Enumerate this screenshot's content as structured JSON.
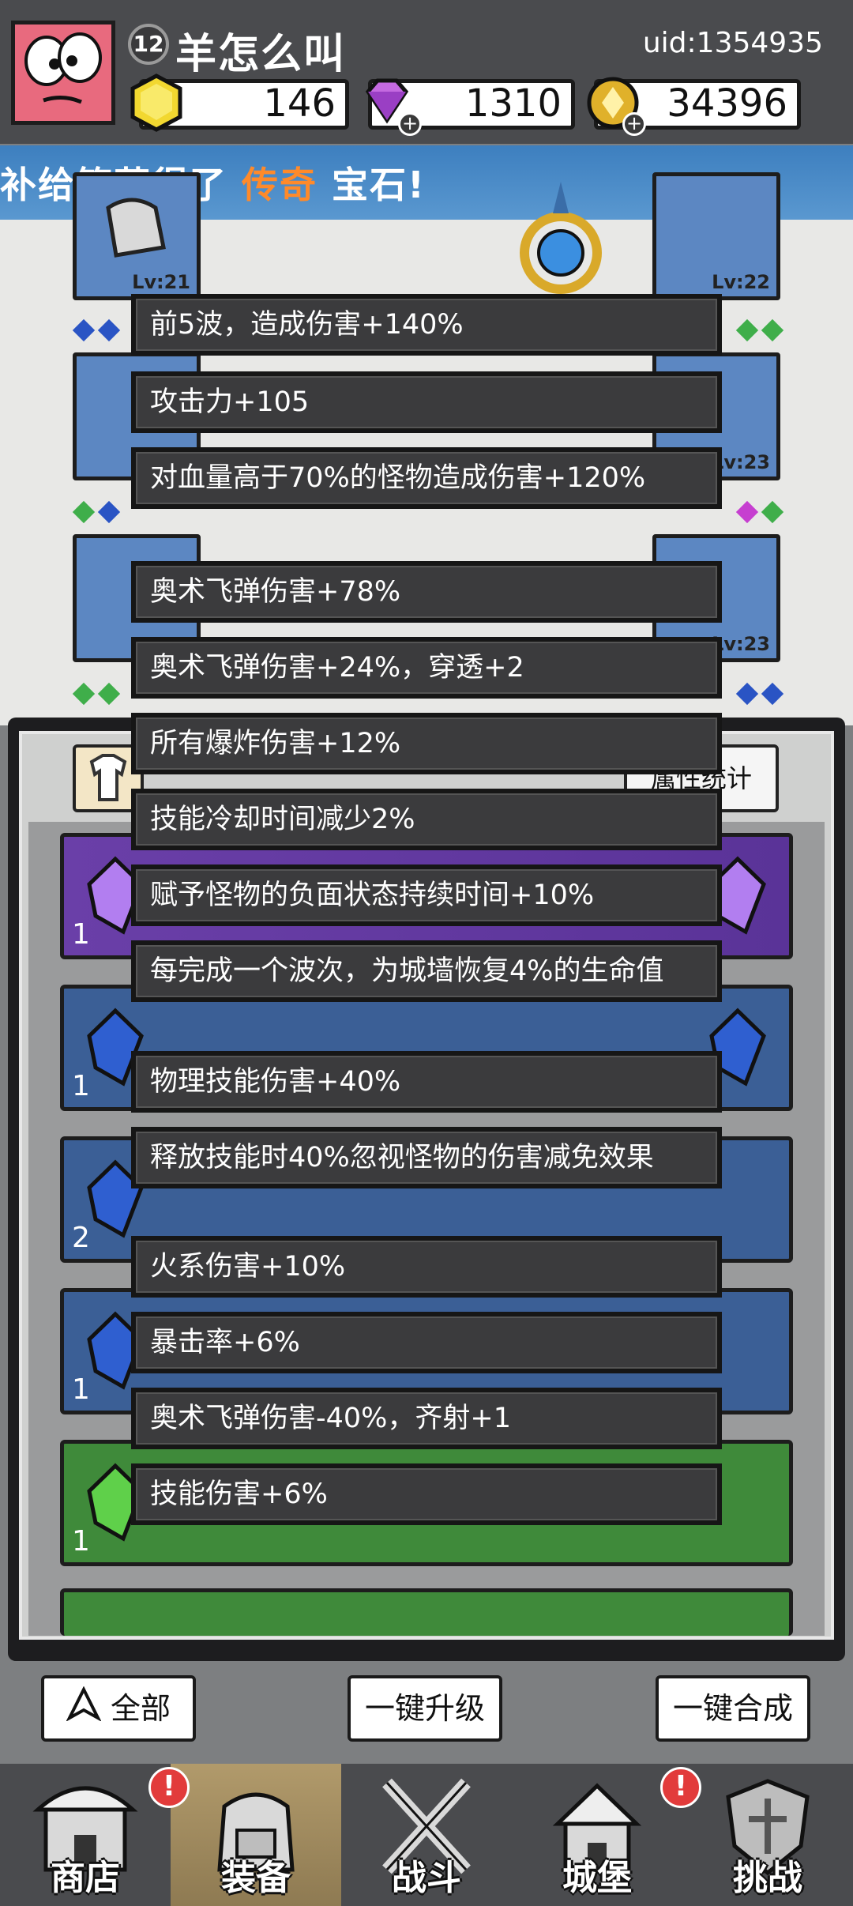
{
  "header": {
    "level": "12",
    "username": "羊怎么叫",
    "uid": "uid:1354935",
    "resources": {
      "gold_gem": "146",
      "diamond": "1310",
      "coin": "34396"
    }
  },
  "banner": {
    "prefix": "补给箱获得了 ",
    "highlight": "传奇",
    "suffix": " 宝石!"
  },
  "equipment_levels": {
    "slot_top_left": "Lv:21",
    "slot_top_right": "Lv:22",
    "slot_mid_right": "Lv:23",
    "slot_low_right": "Lv:23"
  },
  "panel": {
    "stats_button_partial": "属性统计"
  },
  "stats": [
    "前5波，造成伤害+140%",
    "攻击力+105",
    "对血量高于70%的怪物造成伤害+120%",
    "奥术飞弹伤害+78%",
    "奥术飞弹伤害+24%，穿透+2",
    "所有爆炸伤害+12%",
    "技能冷却时间减少2%",
    "赋予怪物的负面状态持续时间+10%",
    "每完成一个波次，为城墙恢复4%的生命值",
    "物理技能伤害+40%",
    "释放技能时40%忽视怪物的伤害减免效果",
    "火系伤害+10%",
    "暴击率+6%",
    "奥术飞弹伤害-40%，齐射+1",
    "技能伤害+6%"
  ],
  "inventory_counts": [
    "1",
    "1",
    "2",
    "1",
    "1"
  ],
  "actions": {
    "filter_all": "全部",
    "upgrade_all": "一键升级",
    "merge_all": "一键合成"
  },
  "nav": {
    "shop": "商店",
    "equipment": "装备",
    "battle": "战斗",
    "castle": "城堡",
    "challenge": "挑战",
    "alert_mark": "!"
  },
  "colors": {
    "legend_highlight": "#ff8a2a",
    "purple_rarity": "#6a3fa8",
    "blue_rarity": "#3b5f96",
    "green_rarity": "#3f8a3a"
  }
}
